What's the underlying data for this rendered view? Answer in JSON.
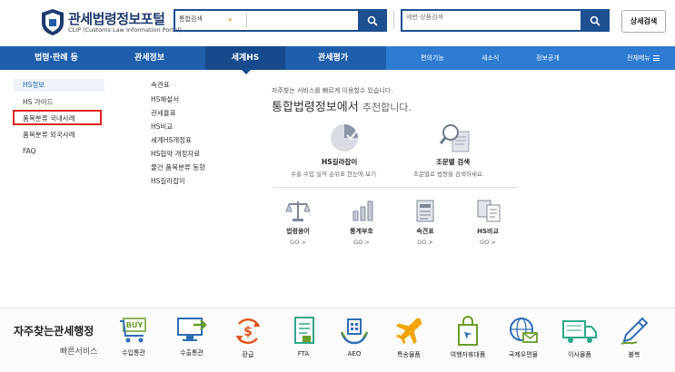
{
  "header": {
    "logo_title": "관세법령정보포털",
    "logo_sub": "CLIP (Customs Law Information Portal)",
    "search1_select": "통합검색",
    "search2_placeholder": "세번·상품검색",
    "adv_search": "상세검색"
  },
  "nav": {
    "items": [
      "법령·판례 등",
      "관세정보",
      "세계HS",
      "관세평가"
    ],
    "right_items": [
      "편의기능",
      "새소식",
      "정보공개"
    ],
    "all_menu": "전체메뉴"
  },
  "left_menu": [
    "HS정보",
    "HS 가이드",
    "품목분류 국내사례",
    "품목분류 외국사례",
    "FAQ"
  ],
  "sub_menu": [
    "속견표",
    "HS해설서",
    "관세율표",
    "HS비교",
    "세계HS개정표",
    "HS협약 개정자료",
    "물건 품목분류 동향",
    "HS길라잡이"
  ],
  "intro": {
    "line1": "자주찾는 서비스를 빠르게 이용할수 있습니다.",
    "line2_main": "통합법령정보에서",
    "line2_sub": "추천합니다."
  },
  "features": [
    {
      "title": "HS길라잡이",
      "desc": "수출 수입 실적 순위표 한눈에 보기"
    },
    {
      "title": "조문별 검색",
      "desc": "조문별로 법령을 검색하세요."
    }
  ],
  "quick": [
    {
      "label": "법령용어",
      "go": "GO >"
    },
    {
      "label": "통계부호",
      "go": "GO >"
    },
    {
      "label": "속견표",
      "go": "GO >"
    },
    {
      "label": "HS비교",
      "go": "GO >"
    }
  ],
  "footer": {
    "title": "자주찾는관세행정",
    "subtitle": "빠른서비스",
    "items": [
      "수입통관",
      "수출통관",
      "환급",
      "FTA",
      "AEO",
      "특송물품",
      "여행자휴대품",
      "국제우편물",
      "이사물품",
      "불복"
    ]
  },
  "colors": {
    "brand": "#1f5eab",
    "nav_right": "#2d7cd1",
    "accent": "#f08a1c",
    "icon_green": "#6a9c2a",
    "icon_blue": "#2d6db5",
    "highlight": "#e02020"
  }
}
